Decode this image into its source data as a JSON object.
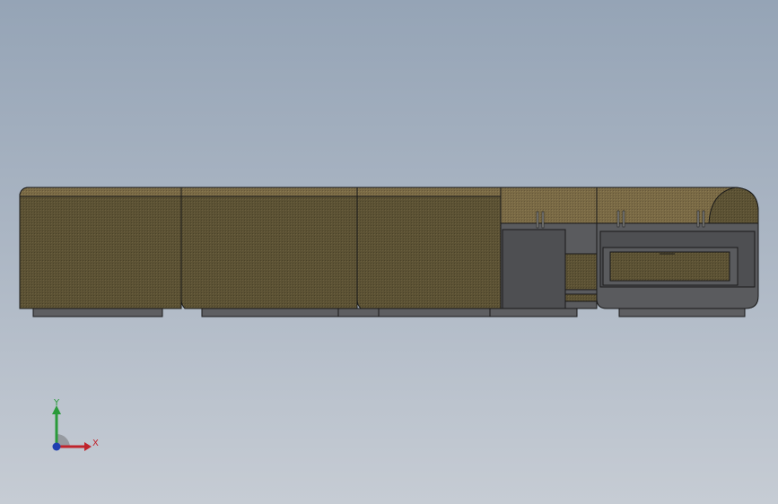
{
  "viewport": {
    "background_top": "#95a4b6",
    "background_bottom": "#c6ccd4"
  },
  "model": {
    "fabric_color": "#5c5234",
    "fabric_top_color": "#7a6a45",
    "metal_color": "#5a5b5e",
    "edge_color": "#1a1a1a"
  },
  "triad": {
    "x_label": "X",
    "y_label": "Y",
    "x_color": "#c0242c",
    "y_color": "#2a9a3a",
    "z_color": "#1f3fb0"
  }
}
